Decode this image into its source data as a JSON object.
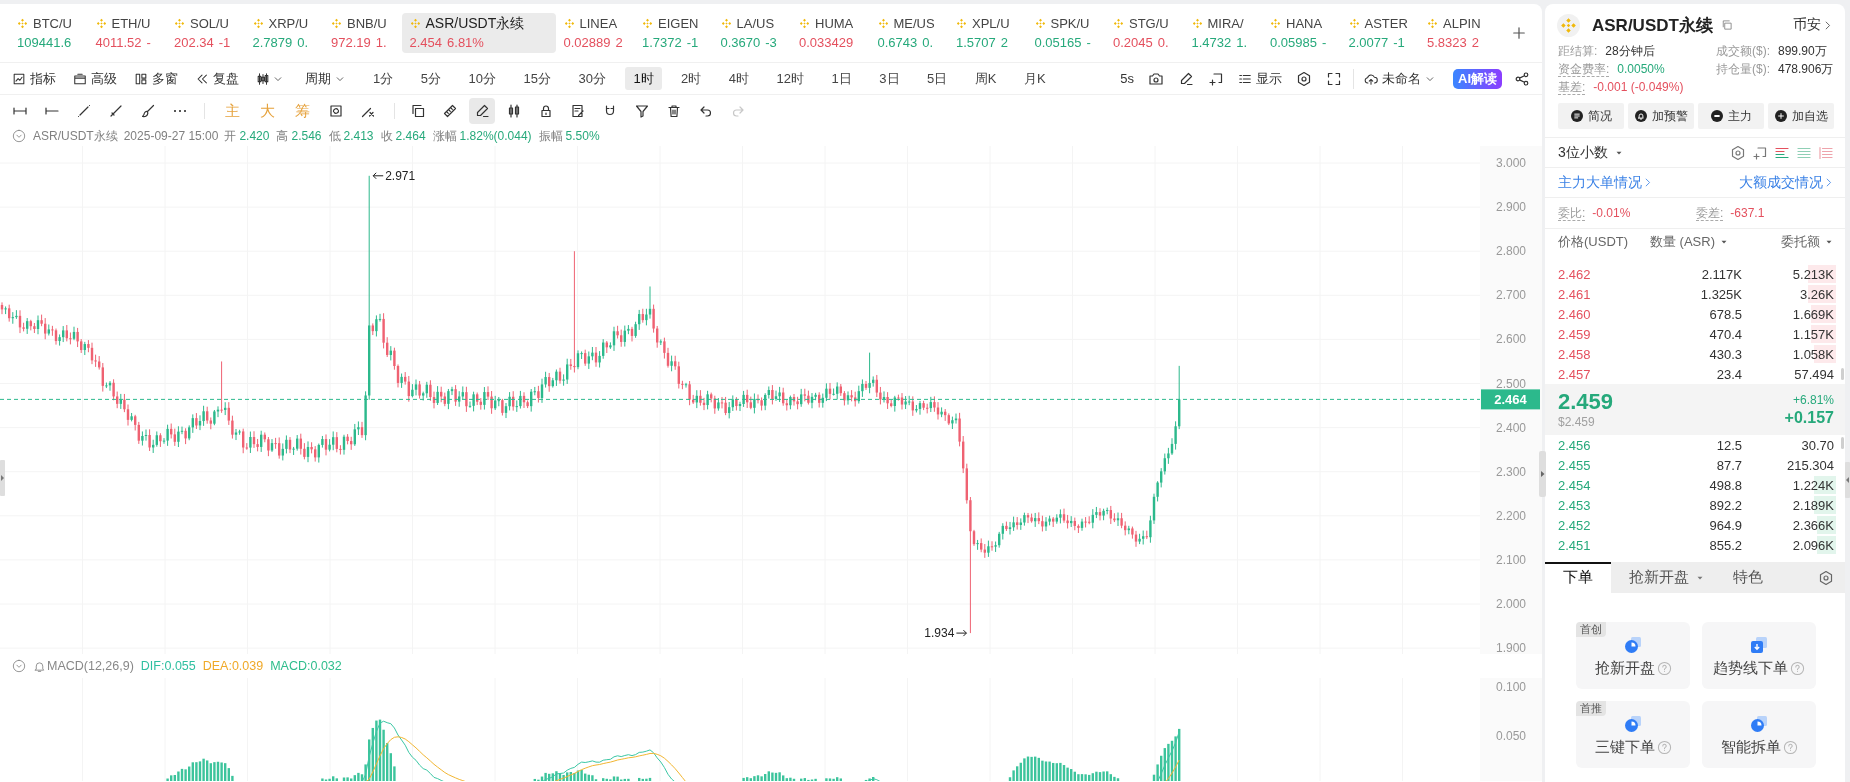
{
  "tickers": [
    {
      "name": "BTC/U",
      "price": "109441.6",
      "color": "#26a97b",
      "selected": false
    },
    {
      "name": "ETH/U",
      "price": "4011.52",
      "change": "-",
      "color": "#e4505e",
      "selected": false
    },
    {
      "name": "SOL/U",
      "price": "202.34",
      "change": "-1",
      "color": "#e4505e",
      "selected": false
    },
    {
      "name": "XRP/U",
      "price": "2.7879",
      "change": "0.",
      "color": "#26a97b",
      "selected": false
    },
    {
      "name": "BNB/U",
      "price": "972.19",
      "change": "1.",
      "color": "#e4505e",
      "selected": false
    },
    {
      "name": "ASR/USDT永续",
      "price": "2.454",
      "change": "6.81%",
      "color": "#e4505e",
      "selected": true
    },
    {
      "name": "LINEA",
      "price": "0.02889",
      "change": "2",
      "color": "#e4505e",
      "selected": false
    },
    {
      "name": "EIGEN",
      "price": "1.7372",
      "change": "-1",
      "color": "#26a97b",
      "selected": false
    },
    {
      "name": "LA/US",
      "price": "0.3670",
      "change": "-3",
      "color": "#26a97b",
      "selected": false
    },
    {
      "name": "HUMA",
      "price": "0.033429",
      "color": "#e4505e",
      "selected": false
    },
    {
      "name": "ME/US",
      "price": "0.6743",
      "change": "0.",
      "color": "#26a97b",
      "selected": false
    },
    {
      "name": "XPL/U",
      "price": "1.5707",
      "change": "2",
      "color": "#26a97b",
      "selected": false
    },
    {
      "name": "SPK/U",
      "price": "0.05165",
      "change": "-",
      "color": "#26a97b",
      "selected": false
    },
    {
      "name": "STG/U",
      "price": "0.2045",
      "change": "0.",
      "color": "#e4505e",
      "selected": false
    },
    {
      "name": "MIRA/",
      "price": "1.4732",
      "change": "1.",
      "color": "#26a97b",
      "selected": false
    },
    {
      "name": "HANA",
      "price": "0.05985",
      "change": "-",
      "color": "#26a97b",
      "selected": false
    },
    {
      "name": "ASTER",
      "price": "2.0077",
      "change": "-1",
      "color": "#26a97b",
      "selected": false
    },
    {
      "name": "ALPIN",
      "price": "5.8323",
      "change": "2",
      "color": "#e4505e",
      "selected": false
    }
  ],
  "toolbar": {
    "tools": [
      {
        "label": "指标"
      },
      {
        "label": "高级"
      },
      {
        "label": "多窗"
      },
      {
        "label": "复盘"
      }
    ],
    "period": "周期",
    "intervals": [
      {
        "label": "1分",
        "selected": false
      },
      {
        "label": "5分",
        "selected": false
      },
      {
        "label": "10分",
        "selected": false
      },
      {
        "label": "15分",
        "selected": false
      },
      {
        "label": "30分",
        "selected": false
      },
      {
        "label": "1时",
        "selected": true
      },
      {
        "label": "2时",
        "selected": false
      },
      {
        "label": "4时",
        "selected": false
      },
      {
        "label": "12时",
        "selected": false
      },
      {
        "label": "1日",
        "selected": false
      },
      {
        "label": "3日",
        "selected": false
      },
      {
        "label": "5日",
        "selected": false
      },
      {
        "label": "周K",
        "selected": false
      },
      {
        "label": "月K",
        "selected": false
      }
    ],
    "refresh": "5s",
    "display": "显示",
    "layout": "未命名",
    "ai": "AI解读"
  },
  "drawing_toolbar": {
    "line_tools": [
      {
        "selected": false
      },
      {
        "selected": false
      },
      {
        "selected": false
      },
      {
        "selected": false
      },
      {
        "selected": false
      },
      {
        "selected": false
      }
    ],
    "overlays": [
      "主",
      "大",
      "筹"
    ],
    "overlay_tools": [
      {
        "selected": false
      },
      {
        "selected": false
      }
    ],
    "object_tools": [
      {
        "selected": false
      },
      {
        "selected": false
      },
      {
        "selected": true
      },
      {
        "selected": false
      },
      {
        "selected": false
      },
      {
        "selected": false
      },
      {
        "selected": false
      },
      {
        "selected": false
      },
      {
        "selected": false
      }
    ],
    "history": [
      {
        "disabled": false
      },
      {
        "disabled": true
      }
    ]
  },
  "legend": {
    "symbol": "ASR/USDT永续",
    "time": "2025-09-27 15:00",
    "fields": [
      {
        "label": "开",
        "value": "2.420"
      },
      {
        "label": "高",
        "value": "2.546"
      },
      {
        "label": "低",
        "value": "2.413"
      },
      {
        "label": "收",
        "value": "2.464"
      },
      {
        "label": "涨幅",
        "value": "1.82%(0.044)"
      },
      {
        "label": "振幅",
        "value": "5.50%"
      }
    ]
  },
  "chart": {
    "yticks": [
      "3.000",
      "2.900",
      "2.800",
      "2.700",
      "2.600",
      "2.500",
      "2.400",
      "2.300",
      "2.200",
      "2.100",
      "2.000",
      "1.900"
    ],
    "high_marker": "2.971",
    "low_marker": "1.934",
    "last_price": "2.464"
  },
  "macd": {
    "title": "MACD(12,26,9)",
    "dif": "DIF:0.055",
    "dea": "DEA:0.039",
    "value": "MACD:0.032",
    "yticks": [
      "0.100",
      "0.050"
    ]
  },
  "panel": {
    "symbol": "ASR/USDT永续",
    "exchange": "币安",
    "stats": [
      {
        "label": "距结算:",
        "value": "28分钟后",
        "color": "#333333",
        "tooltip": false
      },
      {
        "label": "成交额($):",
        "value": "899.90万",
        "color": "#333333",
        "tooltip": false
      },
      {
        "label": "资金费率:",
        "value": "0.0050%",
        "color": "#26a97b",
        "tooltip": true
      },
      {
        "label": "持仓量($):",
        "value": "478.906万",
        "color": "#333333",
        "tooltip": false
      },
      {
        "label": "基差:",
        "value": "-0.001 (-0.049%)",
        "color": "#e4505e",
        "tooltip": true
      }
    ],
    "actions": [
      "简况",
      "加预警",
      "主力",
      "加自选"
    ],
    "decimals": "3位小数",
    "links": [
      "主力大单情况",
      "大额成交情况"
    ],
    "imbalance": [
      {
        "label": "委比:",
        "value": "-0.01%",
        "color": "#e4505e"
      },
      {
        "label": "委差:",
        "value": "-637.1",
        "color": "#e4505e"
      }
    ],
    "columns": [
      {
        "label": "价格(USDT)",
        "dropdown": false
      },
      {
        "label": "数量 (ASR)",
        "dropdown": true
      },
      {
        "label": "委托额",
        "dropdown": true
      }
    ],
    "asks": [
      {
        "price": "2.462",
        "amount": "2.117K",
        "total": "5.213K",
        "level": 0.1
      },
      {
        "price": "2.461",
        "amount": "1.325K",
        "total": "3.26K",
        "level": 0.1
      },
      {
        "price": "2.460",
        "amount": "678.5",
        "total": "1.669K",
        "level": 0.09
      },
      {
        "price": "2.459",
        "amount": "470.4",
        "total": "1.157K",
        "level": 0.09
      },
      {
        "price": "2.458",
        "amount": "430.3",
        "total": "1.058K",
        "level": 0.08
      },
      {
        "price": "2.457",
        "amount": "23.4",
        "total": "57.494"
      }
    ],
    "last": {
      "price": "2.459",
      "usd": "$2.459",
      "change_pct": "+6.81%",
      "change": "+0.157"
    },
    "bids": [
      {
        "price": "2.456",
        "amount": "12.5",
        "total": "30.70"
      },
      {
        "price": "2.455",
        "amount": "87.7",
        "total": "215.304"
      },
      {
        "price": "2.454",
        "amount": "498.8",
        "total": "1.224K",
        "level": 0.08
      },
      {
        "price": "2.453",
        "amount": "892.2",
        "total": "2.189K",
        "level": 0.08
      },
      {
        "price": "2.452",
        "amount": "964.9",
        "total": "2.366K",
        "level": 0.07
      },
      {
        "price": "2.451",
        "amount": "855.2",
        "total": "2.096K",
        "level": 0.07
      }
    ],
    "tabs": [
      {
        "label": "下单",
        "selected": true,
        "dropdown": false
      },
      {
        "label": "抢新开盘",
        "selected": false,
        "dropdown": true
      },
      {
        "label": "特色",
        "selected": false,
        "dropdown": false
      }
    ],
    "features": [
      {
        "label": "抢新开盘",
        "badge": "首创"
      },
      {
        "label": "趋势线下单"
      },
      {
        "label": "三键下单",
        "badge": "首推"
      },
      {
        "label": "智能拆单"
      }
    ]
  }
}
